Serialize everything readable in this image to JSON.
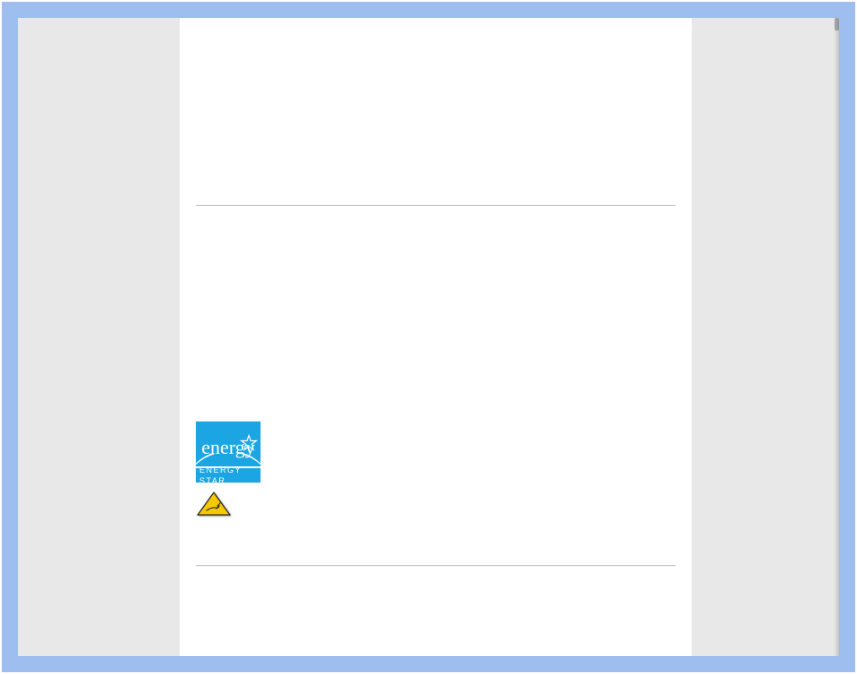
{
  "energy_star": {
    "script_text": "energy",
    "bar_text": "ENERGY STAR"
  },
  "icons": {
    "esd_label": "esd-warning-icon"
  }
}
